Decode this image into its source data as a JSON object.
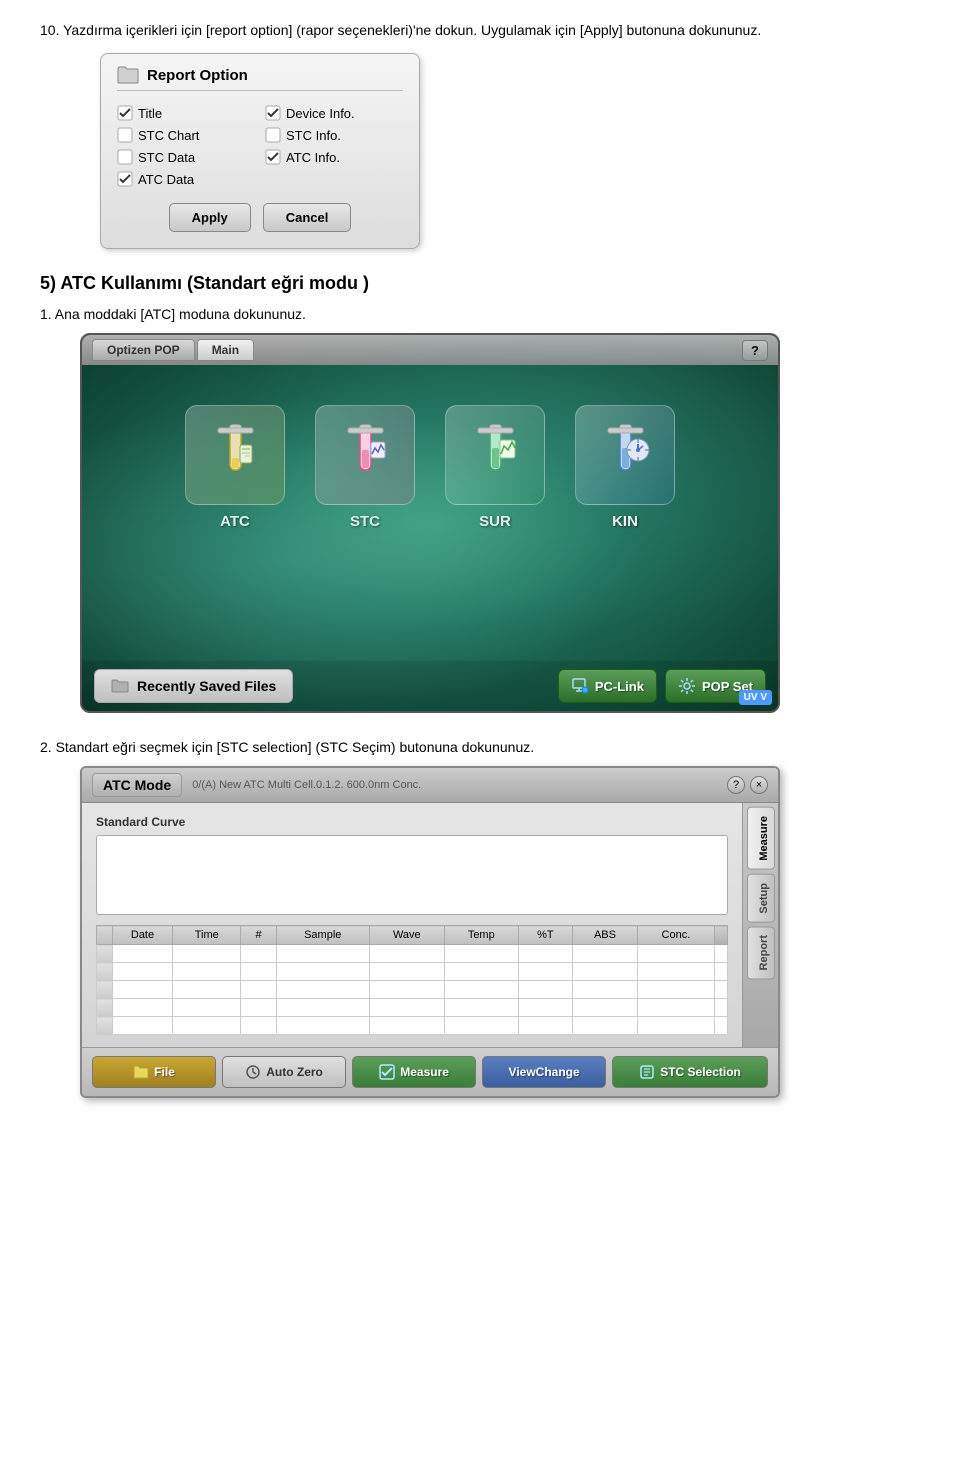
{
  "step10": {
    "text": "10. Yazdırma içerikleri için [report option] (rapor seçenekleri)'ne dokun. Uygulamak için [Apply] butonuna dokununuz."
  },
  "report_option": {
    "title": "Report Option",
    "options": [
      {
        "label": "Title",
        "checked": true,
        "col": 1
      },
      {
        "label": "Device Info.",
        "checked": true,
        "col": 2
      },
      {
        "label": "STC Chart",
        "checked": false,
        "col": 1
      },
      {
        "label": "STC Info.",
        "checked": false,
        "col": 2
      },
      {
        "label": "STC Data",
        "checked": false,
        "col": 1
      },
      {
        "label": "ATC Info.",
        "checked": true,
        "col": 2
      },
      {
        "label": "ATC Data",
        "checked": true,
        "col": 1
      }
    ],
    "apply_label": "Apply",
    "cancel_label": "Cancel"
  },
  "section5": {
    "heading": "5) ATC Kullanımı (Standart eğri modu )",
    "step1": "1.  Ana moddaki [ATC] moduna dokununuz.",
    "step2": "2.  Standart eğri seçmek için [STC selection] (STC Seçim) butonuna dokununuz."
  },
  "main_screen": {
    "tab1": "Optizen POP",
    "tab2": "Main",
    "question": "?",
    "modes": [
      {
        "label": "ATC",
        "color": "#e8c840"
      },
      {
        "label": "STC",
        "color": "#e870a0"
      },
      {
        "label": "SUR",
        "color": "#60b880"
      },
      {
        "label": "KIN",
        "color": "#60a0d0"
      }
    ],
    "recently_saved": "Recently Saved Files",
    "pc_link": "PC-Link",
    "pop_set": "POP Set",
    "uv_badge": "UV V"
  },
  "atc_dialog": {
    "title": "ATC Mode",
    "subtitle": "0/(A) New ATC Multi Cell.0.1.2. 600.0nm Conc.",
    "question": "?",
    "close": "×",
    "standard_curve_label": "Standard Curve",
    "table_headers": [
      "Date",
      "Time",
      "#",
      "Sample",
      "Wave",
      "Temp",
      "%T",
      "ABS",
      "Conc."
    ],
    "sidebar_tabs": [
      "Measure",
      "Setup",
      "Report"
    ],
    "buttons": [
      {
        "label": "File",
        "type": "file"
      },
      {
        "label": "Auto Zero",
        "type": "autozero"
      },
      {
        "label": "Measure",
        "type": "measure"
      },
      {
        "label": "ViewChange",
        "type": "viewchange"
      },
      {
        "label": "STC Selection",
        "type": "stcselection"
      }
    ]
  }
}
